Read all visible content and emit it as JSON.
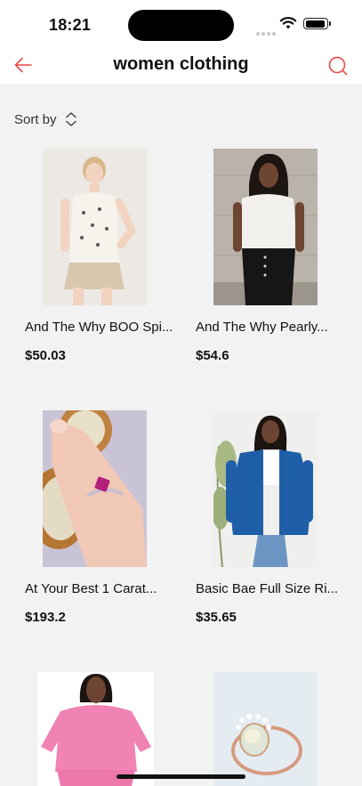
{
  "status": {
    "time": "18:21"
  },
  "header": {
    "title": "women clothing"
  },
  "sort": {
    "label": "Sort by"
  },
  "products": [
    {
      "name": "And The Why BOO Spi...",
      "price": "$50.03"
    },
    {
      "name": "And The Why Pearly...",
      "price": "$54.6"
    },
    {
      "name": "At Your Best 1 Carat...",
      "price": "$193.2"
    },
    {
      "name": "Basic Bae Full Size Ri...",
      "price": "$35.65"
    },
    {
      "name": "",
      "price": ""
    },
    {
      "name": "",
      "price": ""
    }
  ],
  "colors": {
    "accent": "#e8474a",
    "background": "#f2f2f2",
    "text": "#111111"
  },
  "icons": {
    "back": "arrow-left-icon",
    "search": "search-icon",
    "sort": "sort-updown-icon"
  }
}
